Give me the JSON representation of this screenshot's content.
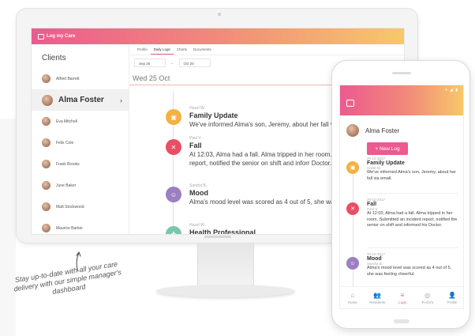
{
  "desktop": {
    "logo_text": "Log my Care",
    "sidebar": {
      "title": "Clients",
      "clients": [
        {
          "name": "Alfred Barrett",
          "active": false
        },
        {
          "name": "Alma Foster",
          "active": true
        },
        {
          "name": "Eva Mitchell",
          "active": false
        },
        {
          "name": "Felix Cole",
          "active": false
        },
        {
          "name": "Frank Brooks",
          "active": false
        },
        {
          "name": "June Baker",
          "active": false
        },
        {
          "name": "Matt Stockwood",
          "active": false
        },
        {
          "name": "Maurice Barker",
          "active": false
        }
      ],
      "chevron": "›"
    },
    "tabs": [
      "Profile",
      "Daily Logs",
      "Charts",
      "Documents"
    ],
    "active_tab": "Daily Logs",
    "range": {
      "from": "Sep 25",
      "sep": "→",
      "to": "Oct 25"
    },
    "day_heading": "Wed 25 Oct",
    "entries": [
      {
        "by": "Hazel W.",
        "title": "Family Update",
        "text": "We've informed Alma's son, Jeremy, about her fall via",
        "icon": "family-update-icon",
        "color": "#f5b041"
      },
      {
        "by": "Paul V.",
        "title": "Fall",
        "text": "At 12:03, Alma had a fall. Alma tripped in her room. S incident report, notified the senior on shift and inforr Doctor.",
        "icon": "fall-icon",
        "color": "#e94f64"
      },
      {
        "by": "Sandra B.",
        "title": "Mood",
        "text": "Alma's mood level was scored as 4 out of 5, she was fe cheerful.",
        "icon": "mood-icon",
        "color": "#9b7fc2"
      },
      {
        "by": "Hazel W.",
        "title": "Health Professional",
        "text": "",
        "icon": "health-professional-icon",
        "color": "#7cc6a8"
      }
    ]
  },
  "phone": {
    "status_icons": "▾ ◢ ▮",
    "profile_name": "Alma Foster",
    "new_log_button": "+ New Log",
    "entries": [
      {
        "date": "25-10-2017",
        "title": "Family Update",
        "by": "Hazel W.",
        "text": "We've informed Alma's son, Jeremy, about her fall via email.",
        "icon": "family-update-icon",
        "color": "#f5b041"
      },
      {
        "date": "25-10-2017",
        "title": "Fall",
        "by": "Paul V.",
        "text": "At 12:03, Alma had a fall. Alma tripped in her room. Submitted an incident report, notified the senior on shift and informed his Doctor.",
        "icon": "fall-icon",
        "color": "#e94f64"
      },
      {
        "date": "25-10-2017",
        "title": "Mood",
        "by": "Sandra B.",
        "text": "Alma's mood level was scored as 4 out of 5, she was feeling cheerful.",
        "icon": "mood-icon",
        "color": "#9b7fc2"
      }
    ],
    "nav": [
      {
        "label": "Home",
        "icon": "home-icon",
        "glyph": "⌂",
        "active": false
      },
      {
        "label": "Residents",
        "icon": "residents-icon",
        "glyph": "👥",
        "active": false
      },
      {
        "label": "Logs",
        "icon": "logs-icon",
        "glyph": "≡",
        "active": true
      },
      {
        "label": "To-Do's",
        "icon": "todo-icon",
        "glyph": "◎",
        "active": false
      },
      {
        "label": "Profile",
        "icon": "profile-icon",
        "glyph": "👤",
        "active": false
      }
    ]
  },
  "caption": "Stay up-to-date with all your care delivery with our simple manager's dashboard",
  "colors": {
    "accent_pink": "#ec5a8f",
    "accent_orange": "#f7c86a"
  }
}
